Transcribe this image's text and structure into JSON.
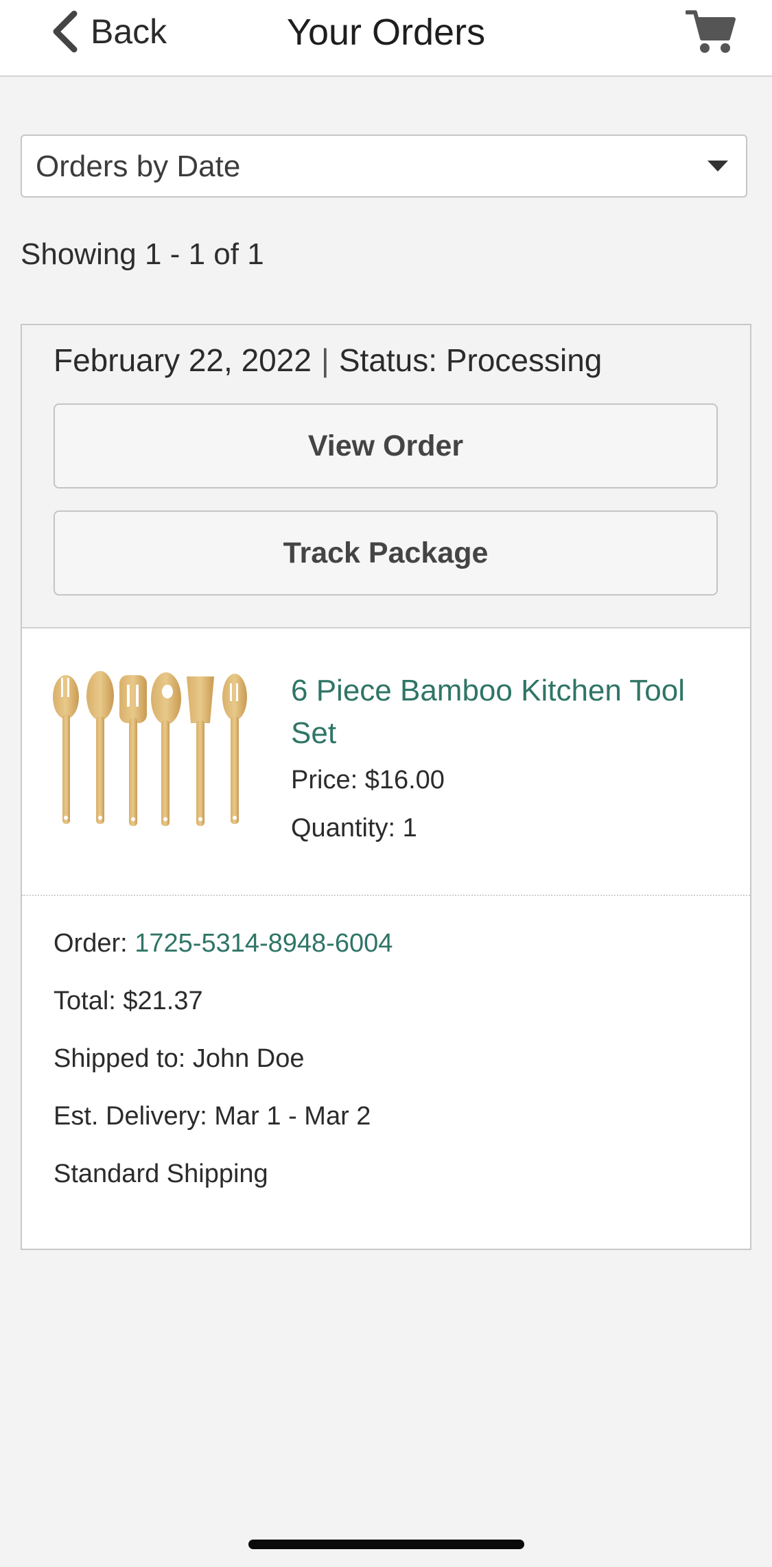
{
  "header": {
    "back_label": "Back",
    "title": "Your Orders",
    "cart_icon": "cart-icon",
    "back_icon": "chevron-left-icon"
  },
  "sort": {
    "selected": "Orders by Date",
    "icon": "caret-down-icon"
  },
  "results": {
    "showing": "Showing 1 - 1 of 1"
  },
  "order": {
    "date": "February 22, 2022",
    "separator": "|",
    "status": "Status: Processing",
    "view_label": "View Order",
    "track_label": "Track Package",
    "item": {
      "name": "6 Piece Bamboo Kitchen Tool Set",
      "price": "Price: $16.00",
      "quantity": "Quantity: 1"
    },
    "order_label": "Order: ",
    "order_number": "1725-5314-8948-6004",
    "total": "Total: $21.37",
    "shipped_to": "Shipped to: John Doe",
    "est_delivery": "Est. Delivery: Mar 1 - Mar 2",
    "shipping_method": "Standard Shipping"
  },
  "colors": {
    "accent_link": "#2f7566",
    "background": "#f3f3f3",
    "card": "#ffffff"
  }
}
